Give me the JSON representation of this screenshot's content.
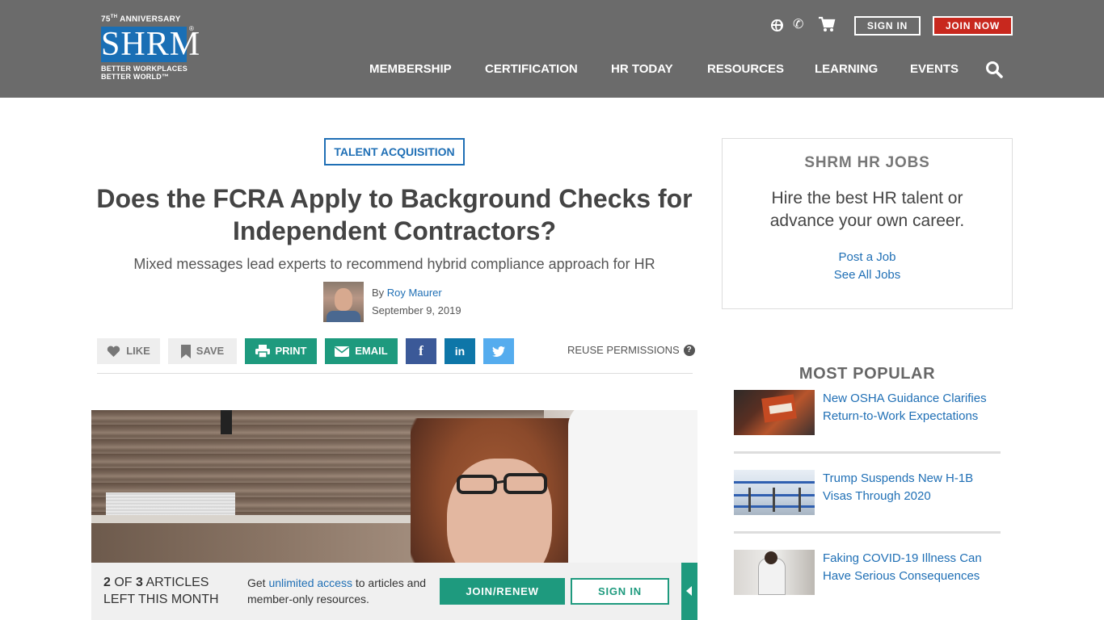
{
  "header": {
    "logo": {
      "anniversary": "75",
      "anniversary_sup": "TH",
      "anniversary_label": "ANNIVERSARY",
      "wordmark": "SHRM",
      "tagline_1": "BETTER WORKPLACES",
      "tagline_2": "BETTER WORLD™"
    },
    "sign_in": "SIGN IN",
    "join_now": "JOIN NOW",
    "nav": [
      "MEMBERSHIP",
      "CERTIFICATION",
      "HR TODAY",
      "RESOURCES",
      "LEARNING",
      "EVENTS"
    ],
    "colors": {
      "bar": "#6b6b6b",
      "join": "#c8281e",
      "logo_blue": "#1a6fb5"
    }
  },
  "article": {
    "topic": "TALENT ACQUISITION",
    "title": "Does the FCRA Apply to Background Checks for Independent Contractors?",
    "subtitle": "Mixed messages lead experts to recommend hybrid compliance approach for HR",
    "by": "By",
    "author": "Roy Maurer",
    "date": "September 9, 2019",
    "share": {
      "like": "LIKE",
      "save": "SAVE",
      "print": "PRINT",
      "email": "EMAIL",
      "facebook": "f",
      "linkedin": "in"
    },
    "reuse": "REUSE PERMISSIONS",
    "help": "?"
  },
  "meter": {
    "count": "2",
    "of": "OF",
    "total": "3",
    "line1_rest": "ARTICLES",
    "line2": "LEFT THIS MONTH",
    "get": "Get",
    "unlimited": "unlimited access",
    "rest": "to articles and member-only resources.",
    "join_renew": "JOIN/RENEW",
    "sign_in": "SIGN IN",
    "colors": {
      "accent": "#1e9a7e"
    }
  },
  "sidebar": {
    "jobs": {
      "title": "SHRM HR JOBS",
      "description": "Hire the best HR talent or advance your own career.",
      "post_job": "Post a Job",
      "see_all": "See All Jobs"
    },
    "popular": {
      "title": "MOST POPULAR",
      "items": [
        {
          "title": "New OSHA Guidance Clarifies Return-to-Work Expectations"
        },
        {
          "title": "Trump Suspends New H-1B Visas Through 2020"
        },
        {
          "title": "Faking COVID-19 Illness Can Have Serious Consequences"
        }
      ]
    }
  }
}
